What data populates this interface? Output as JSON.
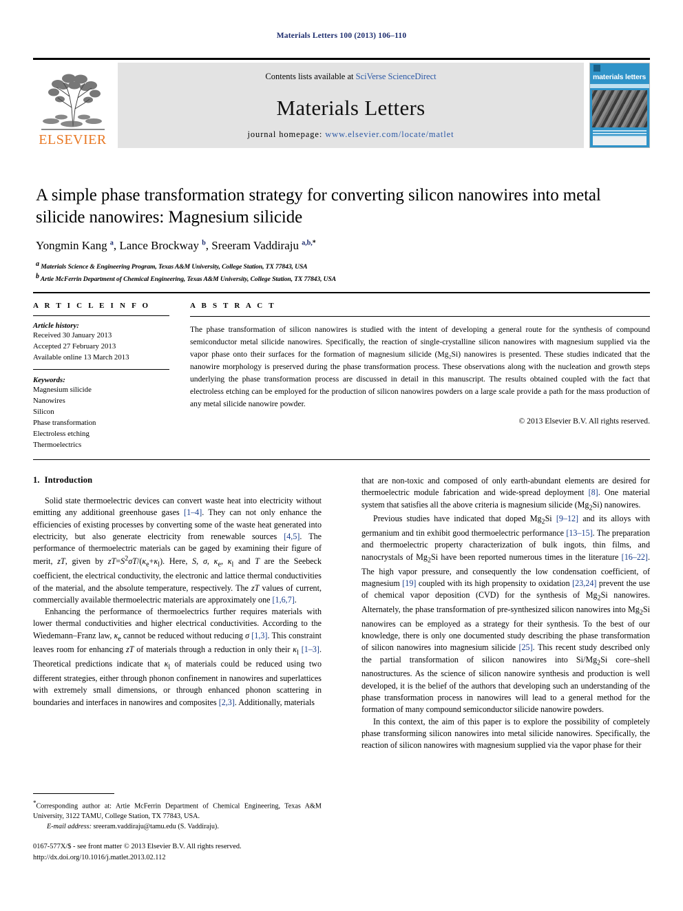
{
  "running_head": "Materials Letters 100 (2013) 106–110",
  "masthead": {
    "contents_prefix": "Contents lists available at ",
    "contents_link": "SciVerse ScienceDirect",
    "journal_title": "Materials Letters",
    "homepage_label": "journal homepage: ",
    "homepage_url": "www.elsevier.com/locate/matlet",
    "publisher_logo_text": "ELSEVIER",
    "cover_title": "materials letters"
  },
  "article": {
    "title": "A simple phase transformation strategy for converting silicon nanowires into metal silicide nanowires: Magnesium silicide",
    "authors_html": "Yongmin Kang <sup>a</sup>, Lance Brockway <sup>b</sup>, Sreeram Vaddiraju <sup>a,b,</sup><sup class=\"star\">*</sup>",
    "affiliation_a": "Materials Science & Engineering Program, Texas A&M University, College Station, TX 77843, USA",
    "affiliation_b": "Artie McFerrin Department of Chemical Engineering, Texas A&M University, College Station, TX 77843, USA"
  },
  "info": {
    "heading": "A R T I C L E   I N F O",
    "history_label": "Article history:",
    "history": [
      "Received 30 January 2013",
      "Accepted 27 February 2013",
      "Available online 13 March 2013"
    ],
    "keywords_label": "Keywords:",
    "keywords": [
      "Magnesium silicide",
      "Nanowires",
      "Silicon",
      "Phase transformation",
      "Electroless etching",
      "Thermoelectrics"
    ]
  },
  "abstract": {
    "heading": "A B S T R A C T",
    "text": "The phase transformation of silicon nanowires is studied with the intent of developing a general route for the synthesis of compound semiconductor metal silicide nanowires. Specifically, the reaction of single-crystalline silicon nanowires with magnesium supplied via the vapor phase onto their surfaces for the formation of magnesium silicide (Mg₂Si) nanowires is presented. These studies indicated that the nanowire morphology is preserved during the phase transformation process. These observations along with the nucleation and growth steps underlying the phase transformation process are discussed in detail in this manuscript. The results obtained coupled with the fact that electroless etching can be employed for the production of silicon nanowires powders on a large scale provide a path for the mass production of any metal silicide nanowire powder.",
    "copyright": "© 2013 Elsevier B.V. All rights reserved."
  },
  "body": {
    "section_number": "1.",
    "section_title": "Introduction",
    "left_paragraphs_html": [
      "Solid state thermoelectric devices can convert waste heat into electricity without emitting any additional greenhouse gases <span class=\"ref\">[1–4]</span>. They can not only enhance the efficiencies of existing processes by converting some of the waste heat generated into electricity, but also generate electricity from renewable sources <span class=\"ref\">[4,5]</span>. The performance of thermoelectric materials can be gaged by examining their figure of merit, <i class=\"v\">zT</i>, given by <i class=\"v\">zT</i>=<i class=\"v\">S</i><sup>2</sup><i class=\"v\">σT</i>/(<i class=\"v\">κ</i><sub>e</sub>+<i class=\"v\">κ</i><sub>l</sub>). Here, <i class=\"v\">S</i>, <i class=\"v\">σ</i>, <i class=\"v\">κ</i><sub>e</sub>, <i class=\"v\">κ</i><sub>l</sub> and <i class=\"v\">T</i> are the Seebeck coefficient, the electrical conductivity, the electronic and lattice thermal conductivities of the material, and the absolute temperature, respectively. The <i class=\"v\">zT</i> values of current, commercially available thermoelectric materials are approximately one <span class=\"ref\">[1,6,7]</span>.",
      "Enhancing the performance of thermoelectrics further requires materials with lower thermal conductivities and higher electrical conductivities. According to the Wiedemann–Franz law, <i class=\"v\">κ</i><sub>e</sub> cannot be reduced without reducing <i class=\"v\">σ</i> <span class=\"ref\">[1,3]</span>. This constraint leaves room for enhancing <i class=\"v\">zT</i> of materials through a reduction in only their <i class=\"v\">κ</i><sub>l</sub> <span class=\"ref\">[1–3]</span>. Theoretical predictions indicate that <i class=\"v\">κ</i><sub>l</sub> of materials could be reduced using two different strategies, either through phonon confinement in nanowires and superlattices with extremely small dimensions, or through enhanced phonon scattering in boundaries and interfaces in nanowires and composites <span class=\"ref\">[2,3]</span>. Additionally, materials"
    ],
    "right_paragraphs_html": [
      "that are non-toxic and composed of only earth-abundant elements are desired for thermoelectric module fabrication and wide-spread deployment <span class=\"ref\">[8]</span>. One material system that satisfies all the above criteria is magnesium silicide (Mg<sub>2</sub>Si) nanowires.",
      "Previous studies have indicated that doped Mg<sub>2</sub>Si <span class=\"ref\">[9–12]</span> and its alloys with germanium and tin exhibit good thermoelectric performance <span class=\"ref\">[13–15]</span>. The preparation and thermoelectric property characterization of bulk ingots, thin films, and nanocrystals of Mg<sub>2</sub>Si have been reported numerous times in the literature <span class=\"ref\">[16–22]</span>. The high vapor pressure, and consequently the low condensation coefficient, of magnesium <span class=\"ref\">[19]</span> coupled with its high propensity to oxidation <span class=\"ref\">[23,24]</span> prevent the use of chemical vapor deposition (CVD) for the synthesis of Mg<sub>2</sub>Si nanowires. Alternately, the phase transformation of pre-synthesized silicon nanowires into Mg<sub>2</sub>Si nanowires can be employed as a strategy for their synthesis. To the best of our knowledge, there is only one documented study describing the phase transformation of silicon nanowires into magnesium silicide <span class=\"ref\">[25]</span>. This recent study described only the partial transformation of silicon nanowires into Si/Mg<sub>2</sub>Si core–shell nanostructures. As the science of silicon nanowire synthesis and production is well developed, it is the belief of the authors that developing such an understanding of the phase transformation process in nanowires will lead to a general method for the formation of many compound semiconductor silicide nanowire powders.",
      "In this context, the aim of this paper is to explore the possibility of completely phase transforming silicon nanowires into metal silicide nanowires. Specifically, the reaction of silicon nanowires with magnesium supplied via the vapor phase for their"
    ]
  },
  "footnotes": {
    "corresponding_html": "<span class=\"fn-star\">*</span>Corresponding author at: Artie McFerrin Department of Chemical Engineering, Texas A&M University, 3122 TAMU, College Station, TX 77843, USA.",
    "email_html": "<i>E-mail address:</i> sreeram.vaddiraju@tamu.edu (S. Vaddiraju)."
  },
  "imprint": {
    "line1": "0167-577X/$ - see front matter © 2013 Elsevier B.V. All rights reserved.",
    "line2": "http://dx.doi.org/10.1016/j.matlet.2013.02.112"
  },
  "colors": {
    "link_blue": "#2a57a5",
    "ref_blue": "#1a3e8c",
    "elsevier_orange": "#E87722",
    "cover_blue": "#2f93c8"
  }
}
